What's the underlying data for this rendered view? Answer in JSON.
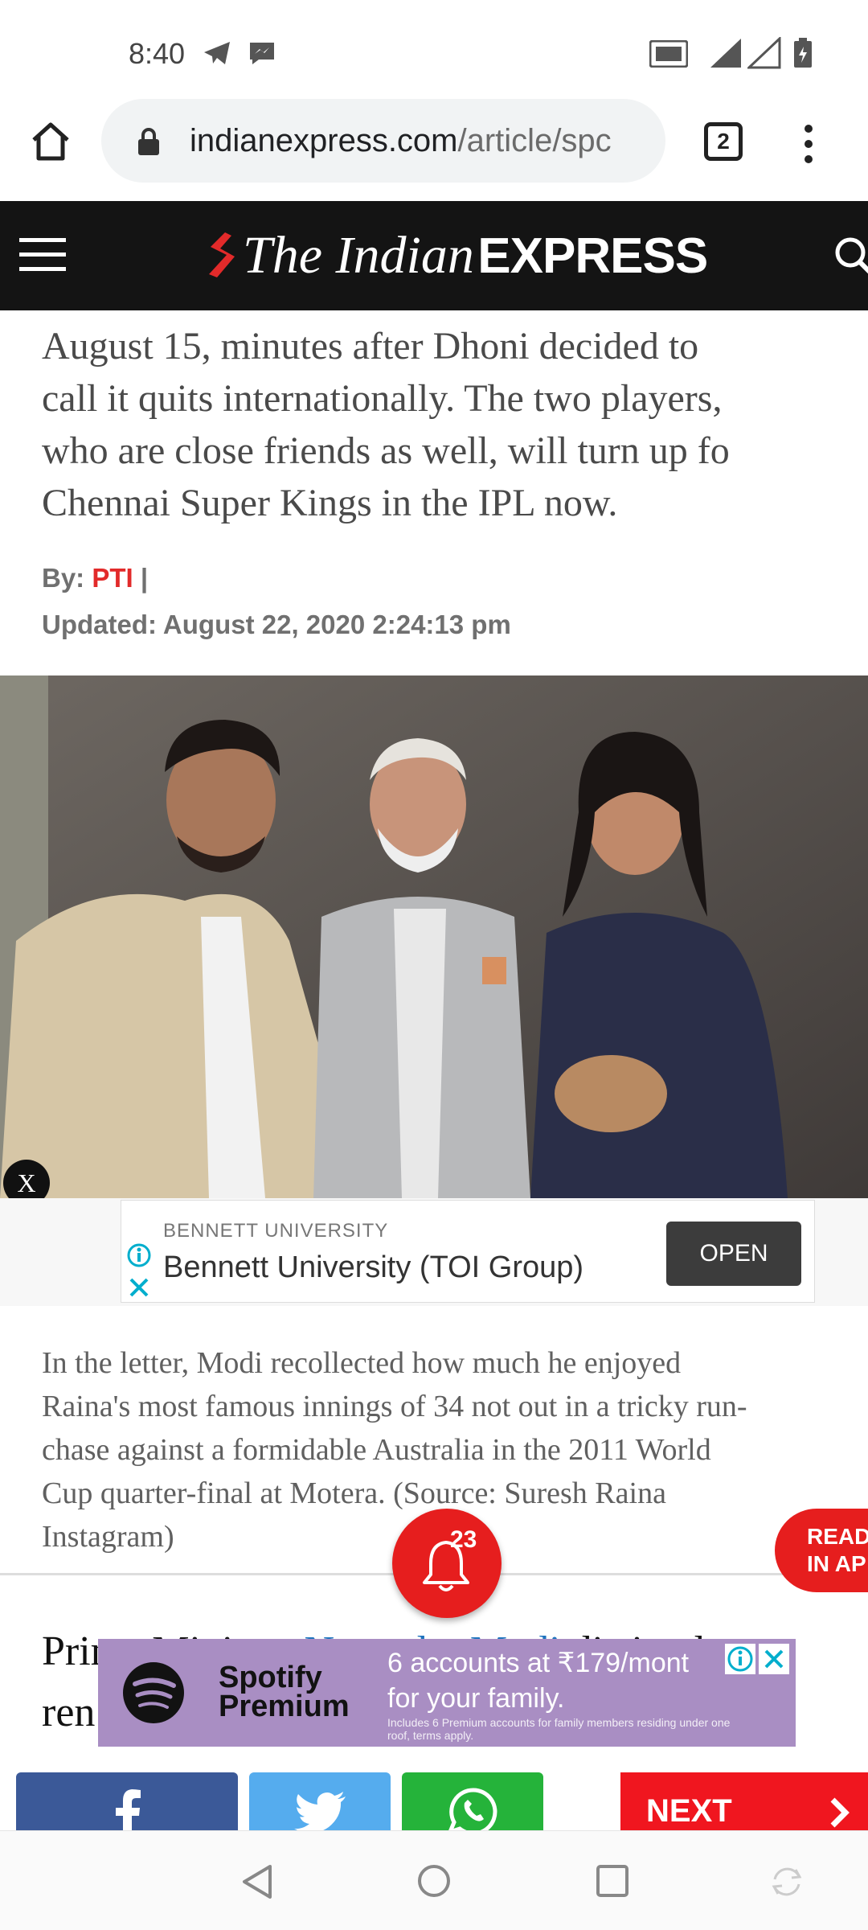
{
  "status_bar": {
    "time": "8:40",
    "left_icons": [
      "telegram-icon",
      "messenger-icon"
    ],
    "right_icons": [
      "volte-icon",
      "signal-4g-icon",
      "signal-icon",
      "battery-charging-icon"
    ]
  },
  "browser": {
    "url_host": "indianexpress.com",
    "url_path": "/article/spc",
    "tab_count": "2"
  },
  "site": {
    "logo_italic": "The Indian",
    "logo_bold": "EXPRESS"
  },
  "article": {
    "lead_lines": [
      "August 15, minutes after Dhoni decided to",
      "call it quits internationally. The two players,",
      "who are close friends as well, will turn up fo",
      "Chennai Super Kings in the IPL now."
    ],
    "byline_prefix": "By:",
    "byline_source": "PTI",
    "byline_sep": "|",
    "updated": "Updated: August 22, 2020 2:24:13 pm",
    "caption_lines": [
      "In the letter, Modi recollected how much he enjoyed",
      "Raina's most famous innings of 34 not out in a tricky run-",
      "chase against a formidable Australia in the 2011 World",
      "Cup quarter-final at Motera. (Source: Suresh Raina",
      "Instagram)"
    ],
    "body_line1_start": "Pri",
    "body_line1_mid": "me Minister ",
    "body_line1_link": "Narendra Modi",
    "body_line1_end": " distinctly",
    "body_line2_start": "ren"
  },
  "ad_bennett": {
    "close_label": "X",
    "advertiser": "BENNETT UNIVERSITY",
    "title": "Bennett University (TOI Group)",
    "cta": "OPEN"
  },
  "notifications": {
    "count": "23"
  },
  "read_in_app": {
    "line1": "READ",
    "line2": "IN AP"
  },
  "ad_spotify": {
    "brand_line1": "Spotify",
    "brand_line2": "Premium",
    "headline_line1": "6 accounts at ₹179/mont",
    "headline_line2": "for your family.",
    "fine_print": "Includes 6 Premium accounts for family members residing under one roof, terms apply."
  },
  "share": {
    "next_label": "NEXT",
    "colors": {
      "facebook": "#3b5998",
      "twitter": "#55acee",
      "whatsapp": "#25b33a",
      "next": "#f0161f"
    }
  }
}
